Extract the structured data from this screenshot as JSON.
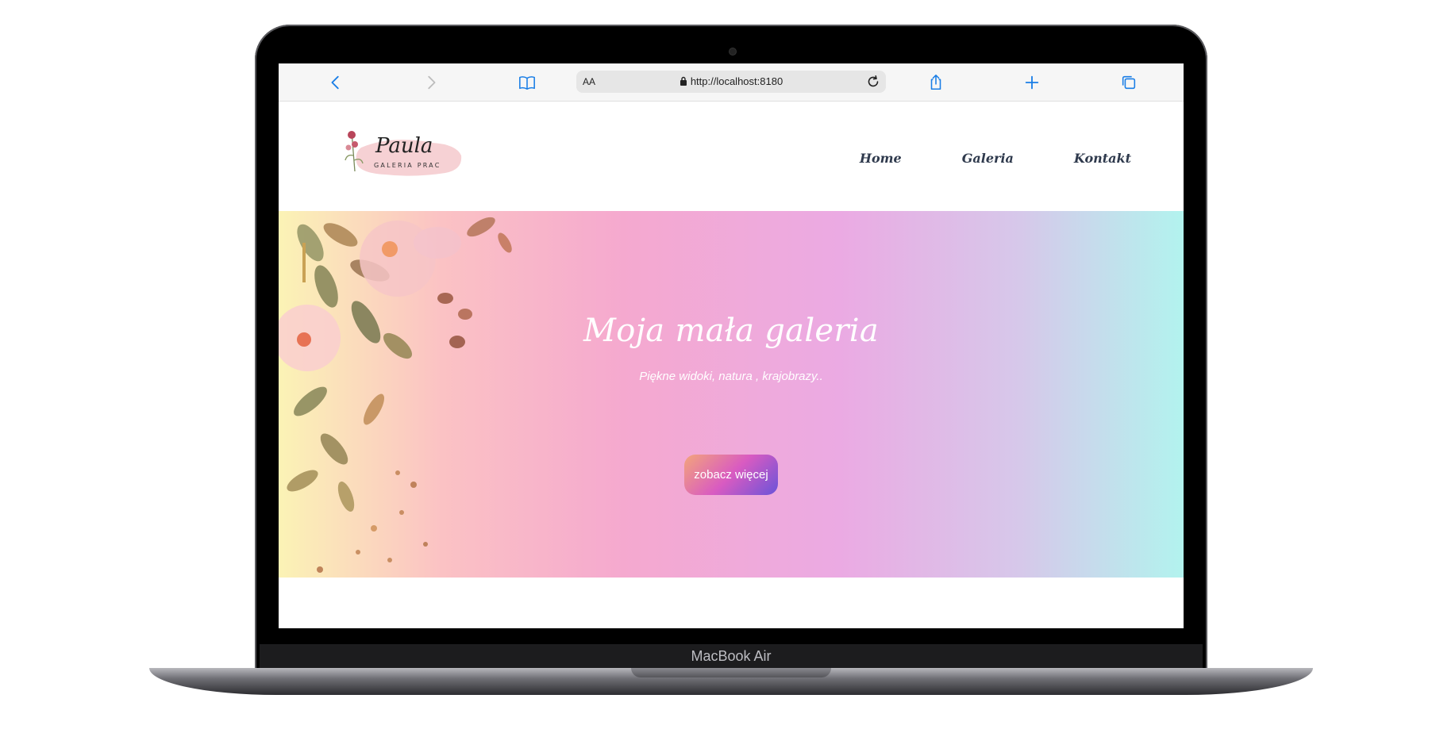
{
  "device": {
    "label": "MacBook Air"
  },
  "browser": {
    "text_size_label": "AA",
    "url": "http://localhost:8180",
    "icons": [
      "back-icon",
      "forward-icon",
      "bookmarks-icon",
      "lock-icon",
      "reload-icon",
      "share-icon",
      "new-tab-icon",
      "tabs-icon"
    ]
  },
  "site": {
    "logo": {
      "name": "Paula",
      "tagline": "GALERIA PRAC"
    },
    "nav": [
      {
        "label": "Home"
      },
      {
        "label": "Galeria"
      },
      {
        "label": "Kontakt"
      }
    ],
    "hero": {
      "title": "Moja mała galeria",
      "subtitle": "Piękne widoki, natura , krajobrazy..",
      "button_label": "zobacz więcej"
    }
  },
  "colors": {
    "nav_text": "#2f3a4d",
    "safari_blue": "#1a7ee6",
    "button_gradient": [
      "#f3a57a",
      "#d95bc1",
      "#6a53d9"
    ]
  }
}
